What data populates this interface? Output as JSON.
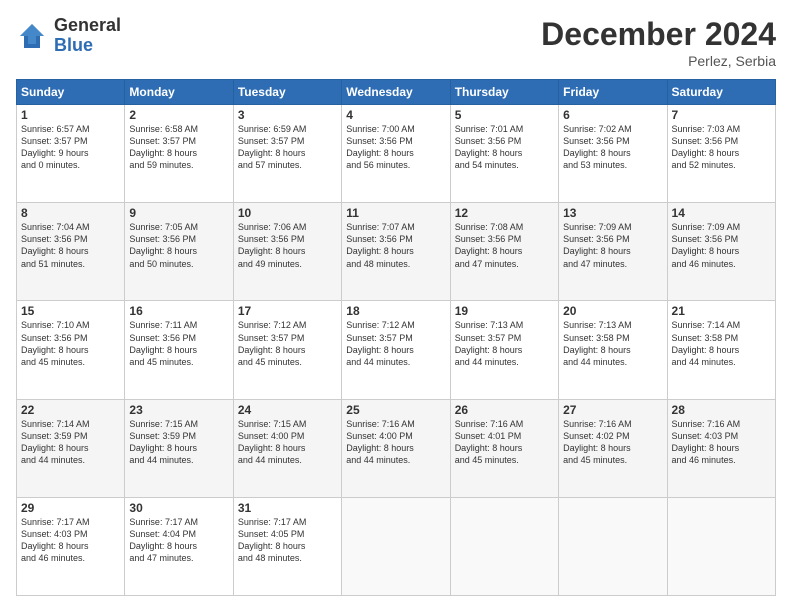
{
  "logo": {
    "general": "General",
    "blue": "Blue"
  },
  "title": "December 2024",
  "location": "Perlez, Serbia",
  "headers": [
    "Sunday",
    "Monday",
    "Tuesday",
    "Wednesday",
    "Thursday",
    "Friday",
    "Saturday"
  ],
  "weeks": [
    [
      {
        "day": "1",
        "info": "Sunrise: 6:57 AM\nSunset: 3:57 PM\nDaylight: 9 hours\nand 0 minutes."
      },
      {
        "day": "2",
        "info": "Sunrise: 6:58 AM\nSunset: 3:57 PM\nDaylight: 8 hours\nand 59 minutes."
      },
      {
        "day": "3",
        "info": "Sunrise: 6:59 AM\nSunset: 3:57 PM\nDaylight: 8 hours\nand 57 minutes."
      },
      {
        "day": "4",
        "info": "Sunrise: 7:00 AM\nSunset: 3:56 PM\nDaylight: 8 hours\nand 56 minutes."
      },
      {
        "day": "5",
        "info": "Sunrise: 7:01 AM\nSunset: 3:56 PM\nDaylight: 8 hours\nand 54 minutes."
      },
      {
        "day": "6",
        "info": "Sunrise: 7:02 AM\nSunset: 3:56 PM\nDaylight: 8 hours\nand 53 minutes."
      },
      {
        "day": "7",
        "info": "Sunrise: 7:03 AM\nSunset: 3:56 PM\nDaylight: 8 hours\nand 52 minutes."
      }
    ],
    [
      {
        "day": "8",
        "info": "Sunrise: 7:04 AM\nSunset: 3:56 PM\nDaylight: 8 hours\nand 51 minutes."
      },
      {
        "day": "9",
        "info": "Sunrise: 7:05 AM\nSunset: 3:56 PM\nDaylight: 8 hours\nand 50 minutes."
      },
      {
        "day": "10",
        "info": "Sunrise: 7:06 AM\nSunset: 3:56 PM\nDaylight: 8 hours\nand 49 minutes."
      },
      {
        "day": "11",
        "info": "Sunrise: 7:07 AM\nSunset: 3:56 PM\nDaylight: 8 hours\nand 48 minutes."
      },
      {
        "day": "12",
        "info": "Sunrise: 7:08 AM\nSunset: 3:56 PM\nDaylight: 8 hours\nand 47 minutes."
      },
      {
        "day": "13",
        "info": "Sunrise: 7:09 AM\nSunset: 3:56 PM\nDaylight: 8 hours\nand 47 minutes."
      },
      {
        "day": "14",
        "info": "Sunrise: 7:09 AM\nSunset: 3:56 PM\nDaylight: 8 hours\nand 46 minutes."
      }
    ],
    [
      {
        "day": "15",
        "info": "Sunrise: 7:10 AM\nSunset: 3:56 PM\nDaylight: 8 hours\nand 45 minutes."
      },
      {
        "day": "16",
        "info": "Sunrise: 7:11 AM\nSunset: 3:56 PM\nDaylight: 8 hours\nand 45 minutes."
      },
      {
        "day": "17",
        "info": "Sunrise: 7:12 AM\nSunset: 3:57 PM\nDaylight: 8 hours\nand 45 minutes."
      },
      {
        "day": "18",
        "info": "Sunrise: 7:12 AM\nSunset: 3:57 PM\nDaylight: 8 hours\nand 44 minutes."
      },
      {
        "day": "19",
        "info": "Sunrise: 7:13 AM\nSunset: 3:57 PM\nDaylight: 8 hours\nand 44 minutes."
      },
      {
        "day": "20",
        "info": "Sunrise: 7:13 AM\nSunset: 3:58 PM\nDaylight: 8 hours\nand 44 minutes."
      },
      {
        "day": "21",
        "info": "Sunrise: 7:14 AM\nSunset: 3:58 PM\nDaylight: 8 hours\nand 44 minutes."
      }
    ],
    [
      {
        "day": "22",
        "info": "Sunrise: 7:14 AM\nSunset: 3:59 PM\nDaylight: 8 hours\nand 44 minutes."
      },
      {
        "day": "23",
        "info": "Sunrise: 7:15 AM\nSunset: 3:59 PM\nDaylight: 8 hours\nand 44 minutes."
      },
      {
        "day": "24",
        "info": "Sunrise: 7:15 AM\nSunset: 4:00 PM\nDaylight: 8 hours\nand 44 minutes."
      },
      {
        "day": "25",
        "info": "Sunrise: 7:16 AM\nSunset: 4:00 PM\nDaylight: 8 hours\nand 44 minutes."
      },
      {
        "day": "26",
        "info": "Sunrise: 7:16 AM\nSunset: 4:01 PM\nDaylight: 8 hours\nand 45 minutes."
      },
      {
        "day": "27",
        "info": "Sunrise: 7:16 AM\nSunset: 4:02 PM\nDaylight: 8 hours\nand 45 minutes."
      },
      {
        "day": "28",
        "info": "Sunrise: 7:16 AM\nSunset: 4:03 PM\nDaylight: 8 hours\nand 46 minutes."
      }
    ],
    [
      {
        "day": "29",
        "info": "Sunrise: 7:17 AM\nSunset: 4:03 PM\nDaylight: 8 hours\nand 46 minutes."
      },
      {
        "day": "30",
        "info": "Sunrise: 7:17 AM\nSunset: 4:04 PM\nDaylight: 8 hours\nand 47 minutes."
      },
      {
        "day": "31",
        "info": "Sunrise: 7:17 AM\nSunset: 4:05 PM\nDaylight: 8 hours\nand 48 minutes."
      },
      null,
      null,
      null,
      null
    ]
  ]
}
